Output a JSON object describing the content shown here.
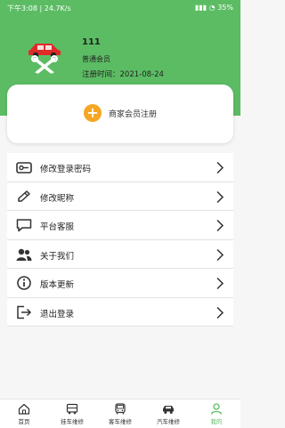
{
  "statusbar": {
    "left_text": "下午3:08 | 24.7K/s",
    "battery": "35"
  },
  "user": {
    "name": "111",
    "level": "普通会员",
    "reg_date": "注册时间：2021-08-24"
  },
  "merchant": {
    "label": "商家会员注册"
  },
  "menu": {
    "items": [
      {
        "label": "修改登录密码",
        "icon": "lock-icon"
      },
      {
        "label": "修改昵称",
        "icon": "pencil-icon"
      },
      {
        "label": "平台客服",
        "icon": "chat-icon"
      },
      {
        "label": "关于我们",
        "icon": "users-icon"
      },
      {
        "label": "版本更新",
        "icon": "info-icon"
      },
      {
        "label": "退出登录",
        "icon": "logout-icon"
      }
    ]
  },
  "tabs": [
    {
      "label": "首页",
      "icon": "home-icon",
      "active": false
    },
    {
      "label": "挂车维修",
      "icon": "truck-icon",
      "active": false
    },
    {
      "label": "客车维修",
      "icon": "bus-icon",
      "active": false
    },
    {
      "label": "汽车维修",
      "icon": "car-icon",
      "active": false
    },
    {
      "label": "我的",
      "icon": "person-icon",
      "active": true
    }
  ],
  "colors": {
    "brand_green": "#5cbc64",
    "accent_orange": "#f5a623"
  }
}
